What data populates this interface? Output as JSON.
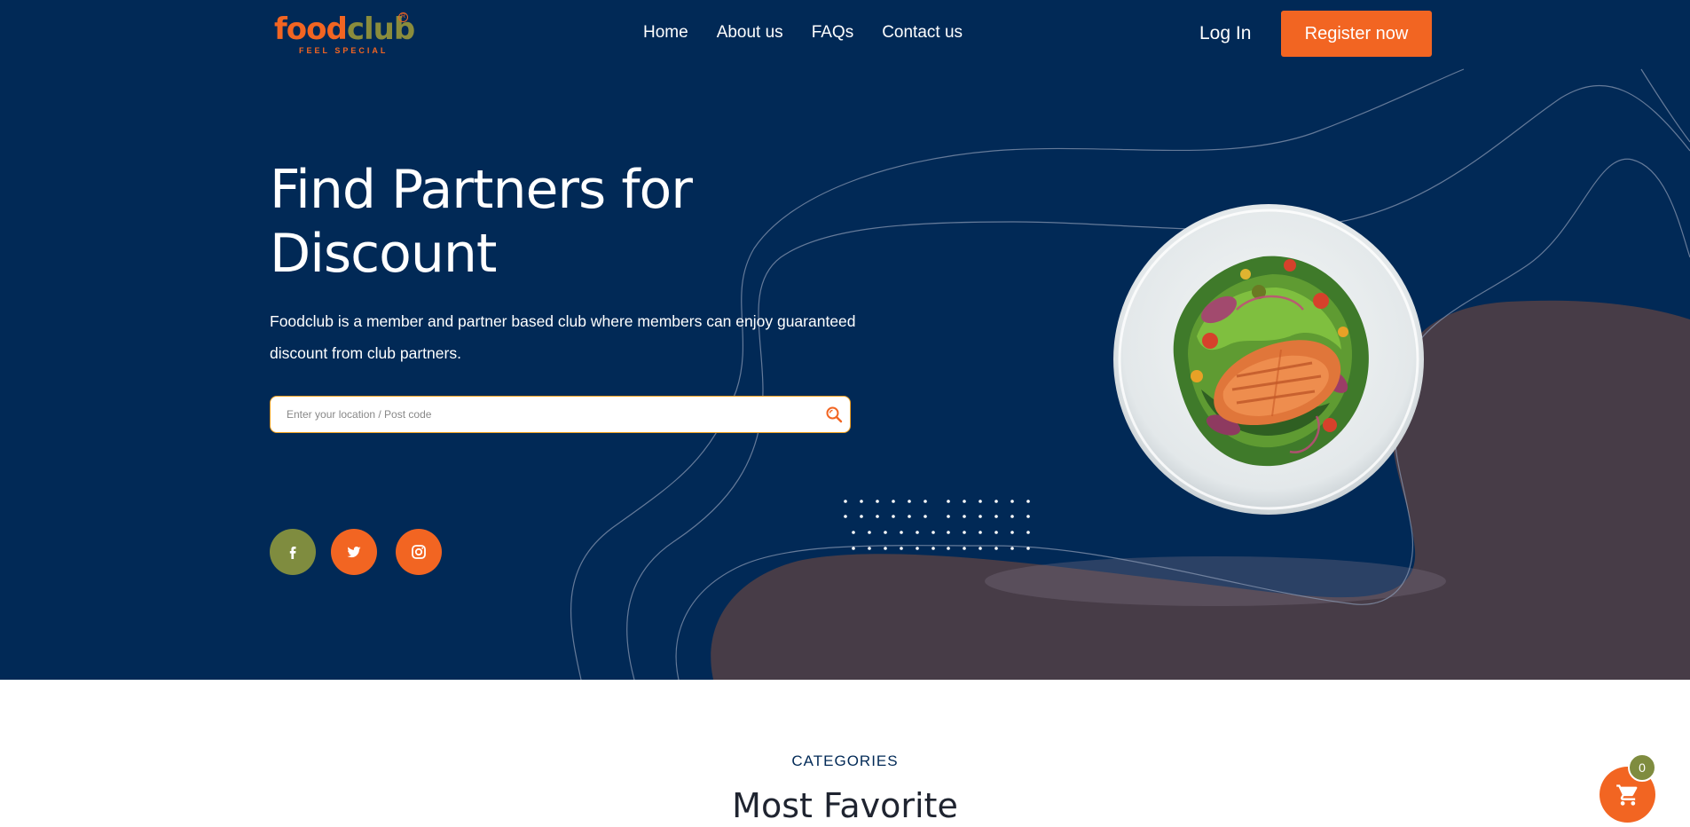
{
  "brand": {
    "logo_food": "food",
    "logo_club": "club",
    "logo_registered": "R",
    "tagline": "FEEL SPECIAL"
  },
  "nav": {
    "items": [
      {
        "label": "Home"
      },
      {
        "label": "About us"
      },
      {
        "label": "FAQs"
      },
      {
        "label": "Contact us"
      }
    ],
    "login_label": "Log In",
    "register_label": "Register now"
  },
  "hero": {
    "headline_line1": "Find Partners for",
    "headline_line2": "Discount",
    "description": "Foodclub is a member and partner based club where members can enjoy guaranteed discount from club partners.",
    "search": {
      "placeholder": "Enter your location / Post code",
      "value": ""
    },
    "image_name": "salmon-salad-plate"
  },
  "social": [
    {
      "icon": "facebook-icon",
      "color": "#7f8c3f"
    },
    {
      "icon": "twitter-icon",
      "color": "#f26522"
    },
    {
      "icon": "instagram-icon",
      "color": "#f26522"
    }
  ],
  "section": {
    "label": "CATEGORIES",
    "title": "Most Favorite"
  },
  "cart": {
    "count": "0",
    "icon": "cart-icon"
  },
  "colors": {
    "navy": "#012956",
    "accent_orange": "#f26522",
    "olive": "#7f8c3f",
    "blob": "#473c47"
  }
}
